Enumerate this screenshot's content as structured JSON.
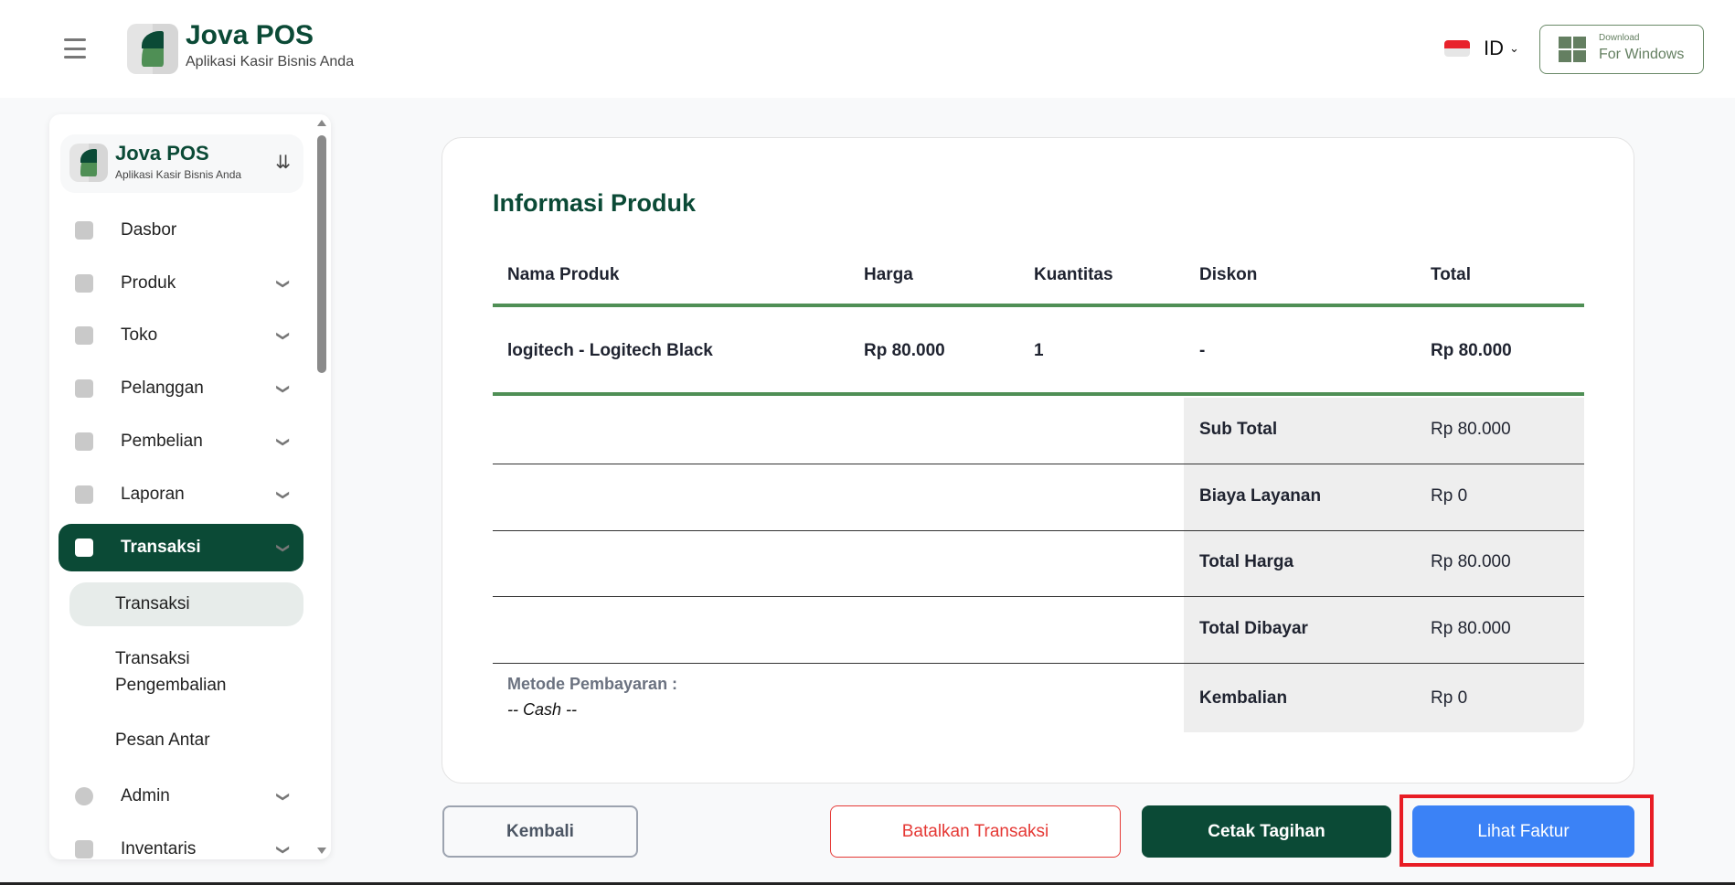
{
  "header": {
    "brand": "Jova POS",
    "tagline": "Aplikasi Kasir Bisnis Anda",
    "language": "ID",
    "download_small": "Download",
    "download_big": "For Windows"
  },
  "sidebar": {
    "brand": "Jova POS",
    "tagline": "Aplikasi Kasir Bisnis Anda",
    "items": [
      {
        "label": "Dasbor"
      },
      {
        "label": "Produk"
      },
      {
        "label": "Toko"
      },
      {
        "label": "Pelanggan"
      },
      {
        "label": "Pembelian"
      },
      {
        "label": "Laporan"
      },
      {
        "label": "Transaksi"
      },
      {
        "label": "Admin"
      },
      {
        "label": "Inventaris"
      }
    ],
    "subitems": [
      {
        "label": "Transaksi"
      },
      {
        "label": "Transaksi Pengembalian"
      },
      {
        "label": "Pesan Antar"
      }
    ]
  },
  "main": {
    "title": "Informasi Produk",
    "columns": [
      "Nama Produk",
      "Harga",
      "Kuantitas",
      "Diskon",
      "Total"
    ],
    "rows": [
      [
        "logitech - Logitech Black",
        "Rp 80.000",
        "1",
        "-",
        "Rp 80.000"
      ]
    ],
    "summary": [
      {
        "label": "Sub Total",
        "value": "Rp 80.000"
      },
      {
        "label": "Biaya Layanan",
        "value": "Rp 0"
      },
      {
        "label": "Total Harga",
        "value": "Rp 80.000"
      },
      {
        "label": "Total Dibayar",
        "value": "Rp 80.000"
      },
      {
        "label": "Kembalian",
        "value": "Rp 0"
      }
    ],
    "payment_label": "Metode Pembayaran :",
    "payment_value": "-- Cash --"
  },
  "buttons": {
    "back": "Kembali",
    "cancel": "Batalkan Transaksi",
    "print": "Cetak Tagihan",
    "invoice": "Lihat Faktur"
  },
  "colors": {
    "brand": "#0b4a36",
    "accent_green": "#4f8f55",
    "invoice_blue": "#3b82f6",
    "cancel_red": "#e53935"
  }
}
